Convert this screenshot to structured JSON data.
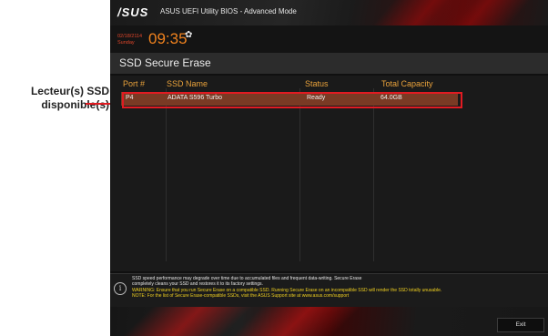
{
  "callout": {
    "line1": "Lecteur(s) SSD",
    "line2": "disponible(s)"
  },
  "header": {
    "logo": "/SUS",
    "title": "ASUS UEFI Utility BIOS - Advanced Mode"
  },
  "clock": {
    "date_line1": "02/18/2114",
    "date_line2": "Sunday",
    "time": "09:35"
  },
  "page": {
    "heading": "SSD Secure Erase"
  },
  "table": {
    "columns": [
      "Port #",
      "SSD Name",
      "Status",
      "Total Capacity"
    ],
    "rows": [
      {
        "port": "P4",
        "name": "ADATA S596 Turbo",
        "status": "Ready",
        "capacity": "64.0GB"
      }
    ]
  },
  "info": {
    "line1": "SSD speed performance may degrade over time due to accumulated files and frequent data-writing. Secure Erase",
    "line2": "completely cleans your SSD and restores it to its factory settings.",
    "line3": "WARNING: Ensure that you run Secure Erase on a compatible SSD. Running Secure Erase on an incompatible SSD will render the SSD totally unusable.",
    "line4": "NOTE: For the list of Secure Erase-compatible SSDs, visit the ASUS Support site at www.asus.com/support"
  },
  "footer": {
    "exit_label": "Exit"
  },
  "icons": {
    "settings": "gear-icon",
    "info": "info-icon"
  },
  "colors": {
    "accent_orange": "#f0821e",
    "highlight_red": "#e11b22",
    "header_yellow": "#e9a23b",
    "warning_yellow": "#f0d020",
    "selected_row": "#7a3a24"
  }
}
